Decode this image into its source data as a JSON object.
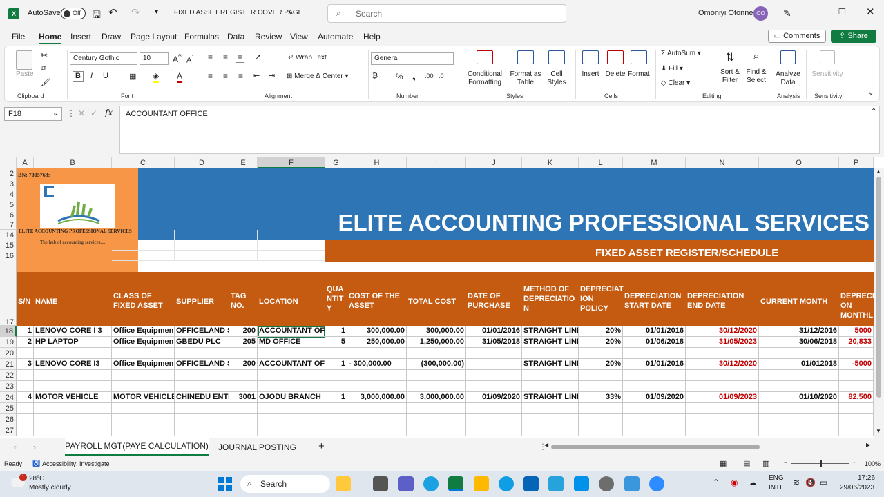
{
  "titlebar": {
    "autosave_label": "AutoSave",
    "autosave_state": "Off",
    "doc_title": "FIXED ASSET REGISTER COVER PAGE",
    "search_placeholder": "Search",
    "user_name": "Omoniyi Otonne",
    "user_initials": "OO"
  },
  "menu": [
    "File",
    "Home",
    "Insert",
    "Draw",
    "Page Layout",
    "Formulas",
    "Data",
    "Review",
    "View",
    "Automate",
    "Help"
  ],
  "comments_label": "Comments",
  "share_label": "Share",
  "ribbon": {
    "paste": "Paste",
    "clipboard": "Clipboard",
    "font_name": "Century Gothic",
    "font_size": "10",
    "font": "Font",
    "wrap": "Wrap Text",
    "merge": "Merge & Center",
    "alignment": "Alignment",
    "numformat": "General",
    "number": "Number",
    "cond": "Conditional\nFormatting",
    "format_table": "Format as\nTable",
    "cell_styles": "Cell\nStyles",
    "styles": "Styles",
    "insert": "Insert",
    "delete": "Delete",
    "format": "Format",
    "cells": "Cells",
    "autosum": "AutoSum",
    "fill": "Fill",
    "clear": "Clear",
    "sort": "Sort &\nFilter",
    "find": "Find &\nSelect",
    "editing": "Editing",
    "analyze": "Analyze\nData",
    "analysis": "Analysis",
    "sensitivity": "Sensitivity"
  },
  "formula": {
    "namebox": "F18",
    "content": "ACCOUNTANT OFFICE"
  },
  "columns": [
    "A",
    "B",
    "C",
    "D",
    "E",
    "F",
    "G",
    "H",
    "I",
    "J",
    "K",
    "L",
    "M",
    "N",
    "O",
    "P"
  ],
  "rows": [
    "2",
    "3",
    "4",
    "5",
    "6",
    "7",
    "14",
    "15",
    "16",
    "17",
    "18",
    "19",
    "20",
    "21",
    "22",
    "23",
    "24",
    "25",
    "26",
    "27"
  ],
  "logo": {
    "bn": "BN: 7005763:",
    "company_small": "ELITE ACCOUNTING PROFESSIONAL SERVICES",
    "tagline": "The hub of accounting services...."
  },
  "banner": {
    "title": "ELITE ACCOUNTING PROFESSIONAL SERVICES",
    "subtitle": "FIXED ASSET REGISTER/SCHEDULE"
  },
  "headers": [
    "S/N",
    "NAME",
    "CLASS OF FIXED ASSET",
    "SUPPLIER",
    "TAG NO.",
    "LOCATION",
    "QUA NTIT Y",
    "COST OF THE ASSET",
    "TOTAL COST",
    "DATE OF PURCHASE",
    "METHOD OF DEPRECIATIO N",
    "DEPRECIAT ION POLICY",
    "DEPRECIATION START DATE",
    "DEPRECIATION END DATE",
    "CURRENT MONTH",
    "DEPRECI ON MONTHL"
  ],
  "data": [
    {
      "row": "18",
      "cells": [
        "1",
        "LENOVO CORE I 3",
        "Office Equipmen",
        "OFFICELAND S",
        "200",
        "ACCOUNTANT OF",
        "1",
        "300,000.00",
        "300,000.00",
        "01/01/2016",
        "STRAIGHT LINE",
        "20%",
        "01/01/2016",
        "30/12/2020",
        "31/12/2016",
        "5000"
      ]
    },
    {
      "row": "19",
      "cells": [
        "2",
        "HP LAPTOP",
        "Office Equipmen",
        "GBEDU PLC",
        "205",
        "MD OFFICE",
        "5",
        "250,000.00",
        "1,250,000.00",
        "31/05/2018",
        "STRAIGHT LINE",
        "20%",
        "01/06/2018",
        "31/05/2023",
        "30/06/2018",
        "20,833"
      ]
    },
    {
      "row": "21",
      "cells": [
        "3",
        "LENOVO CORE I3",
        "Office Equipmen",
        "OFFICELAND S",
        "200",
        "ACCOUNTANT OF",
        "1",
        "- 300,000.00",
        "(300,000.00)",
        "",
        "STRAIGHT LINE",
        "20%",
        "01/01/2016",
        "30/12/2020",
        "01/012018",
        "-5000"
      ]
    },
    {
      "row": "24",
      "cells": [
        "4",
        "MOTOR VEHICLE",
        "MOTOR VEHICLE",
        "CHINEDU ENTE",
        "3001",
        "OJODU BRANCH",
        "1",
        "3,000,000.00",
        "3,000,000.00",
        "01/09/2020",
        "STRAIGHT LINE",
        "33%",
        "01/09/2020",
        "01/09/2023",
        "01/10/2020",
        "82,500"
      ]
    }
  ],
  "tabs": [
    "PAYROLL MGT(PAYE CALCULATION)",
    "JOURNAL POSTING"
  ],
  "status": {
    "ready": "Ready",
    "accessibility": "Accessibility: Investigate",
    "zoom": "100%"
  },
  "taskbar": {
    "temp": "28°C",
    "weather": "Mostly cloudy",
    "search": "Search",
    "lang": "ENG",
    "lang2": "INTL",
    "time": "17:26",
    "date": "29/06/2023",
    "badge": "1"
  },
  "colors": {
    "accent": "#107c41",
    "orange": "#c55a11",
    "blue": "#2e75b6",
    "logo_bg": "#f79646"
  }
}
